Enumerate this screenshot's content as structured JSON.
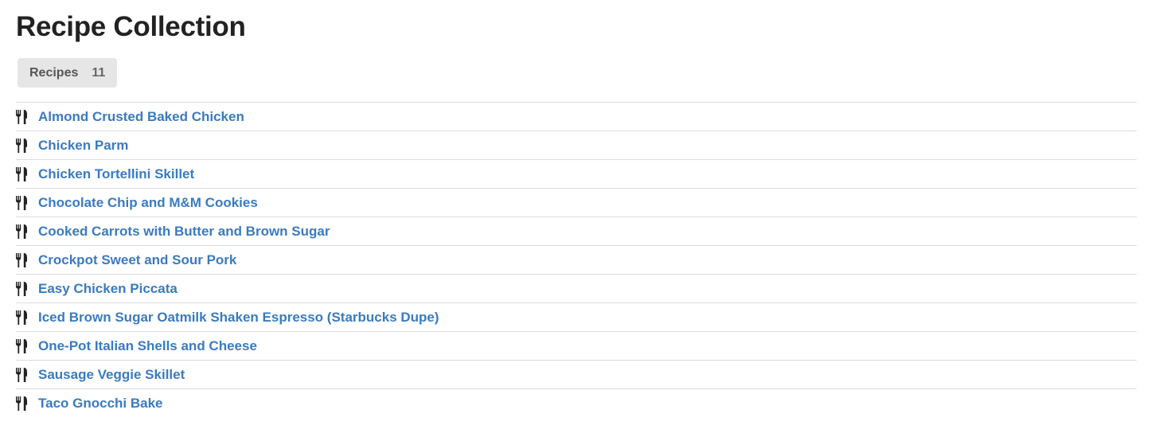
{
  "header": {
    "title": "Recipe Collection"
  },
  "tabs": [
    {
      "label": "Recipes",
      "count": "11"
    }
  ],
  "recipes": [
    "Almond Crusted Baked Chicken",
    "Chicken Parm",
    "Chicken Tortellini Skillet",
    "Chocolate Chip and M&M Cookies",
    "Cooked Carrots with Butter and Brown Sugar",
    "Crockpot Sweet and Sour Pork",
    "Easy Chicken Piccata",
    "Iced Brown Sugar Oatmilk Shaken Espresso (Starbucks Dupe)",
    "One-Pot Italian Shells and Cheese",
    "Sausage Veggie Skillet",
    "Taco Gnocchi Bake"
  ],
  "icons": {
    "recipe_item": "utensils-icon"
  },
  "colors": {
    "link": "#3a7bbf",
    "tab_background": "#e6e6e6",
    "title": "#222222",
    "divider": "#dcdcdc"
  }
}
